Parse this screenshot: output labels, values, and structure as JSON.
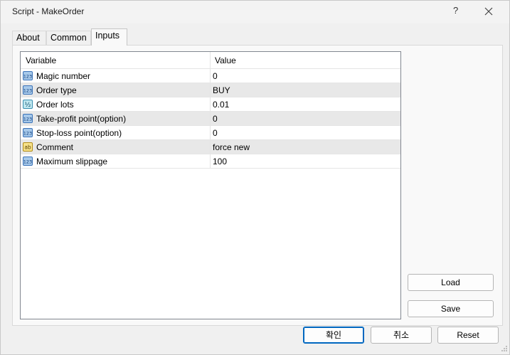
{
  "window": {
    "title": "Script - MakeOrder",
    "help_label": "?"
  },
  "tabs": [
    {
      "label": "About"
    },
    {
      "label": "Common"
    },
    {
      "label": "Inputs"
    }
  ],
  "grid": {
    "headers": {
      "variable": "Variable",
      "value": "Value"
    },
    "rows": [
      {
        "icon": "integer-icon",
        "variable": "Magic number",
        "value": "0"
      },
      {
        "icon": "integer-icon",
        "variable": "Order type",
        "value": "BUY"
      },
      {
        "icon": "double-icon",
        "variable": "Order lots",
        "value": "0.01"
      },
      {
        "icon": "integer-icon",
        "variable": "Take-profit point(option)",
        "value": "0"
      },
      {
        "icon": "integer-icon",
        "variable": "Stop-loss point(option)",
        "value": "0"
      },
      {
        "icon": "string-icon",
        "variable": "Comment",
        "value": "force new"
      },
      {
        "icon": "integer-icon",
        "variable": "Maximum slippage",
        "value": "100"
      }
    ]
  },
  "side_buttons": {
    "load": "Load",
    "save": "Save"
  },
  "footer_buttons": {
    "ok": "확인",
    "cancel": "취소",
    "reset": "Reset"
  },
  "icons": {
    "integer": "123",
    "double": "½",
    "string": "ab"
  }
}
